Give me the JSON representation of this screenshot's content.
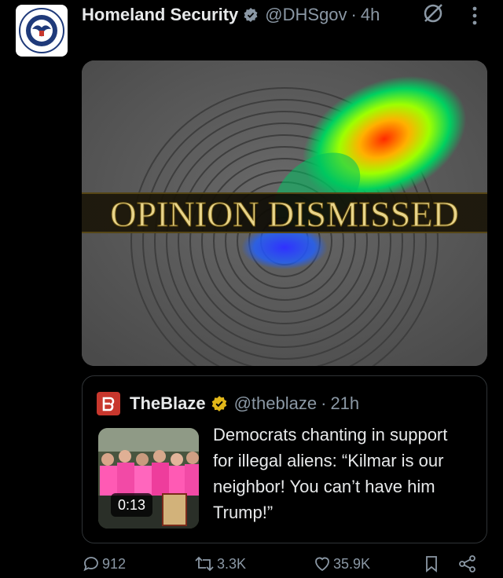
{
  "tweet": {
    "author_name": "Homeland Security",
    "handle": "@DHSgov",
    "separator": "·",
    "time": "4h",
    "image_text": "OPINION DISMISSED"
  },
  "quote": {
    "author_name": "TheBlaze",
    "handle": "@theblaze",
    "separator": "·",
    "time": "21h",
    "video_duration": "0:13",
    "text": "Democrats chanting in support for illegal aliens: “Kilmar is our neighbor! You can’t have him Trump!”"
  },
  "actions": {
    "replies": "912",
    "reposts": "3.3K",
    "likes": "35.9K"
  },
  "colors": {
    "background": "#000000",
    "text_primary": "#e7e9ea",
    "text_secondary": "#8b98a5",
    "verified_blue": "#1d9bf0",
    "verified_gold": "#e2b719",
    "border": "#2f3336"
  }
}
